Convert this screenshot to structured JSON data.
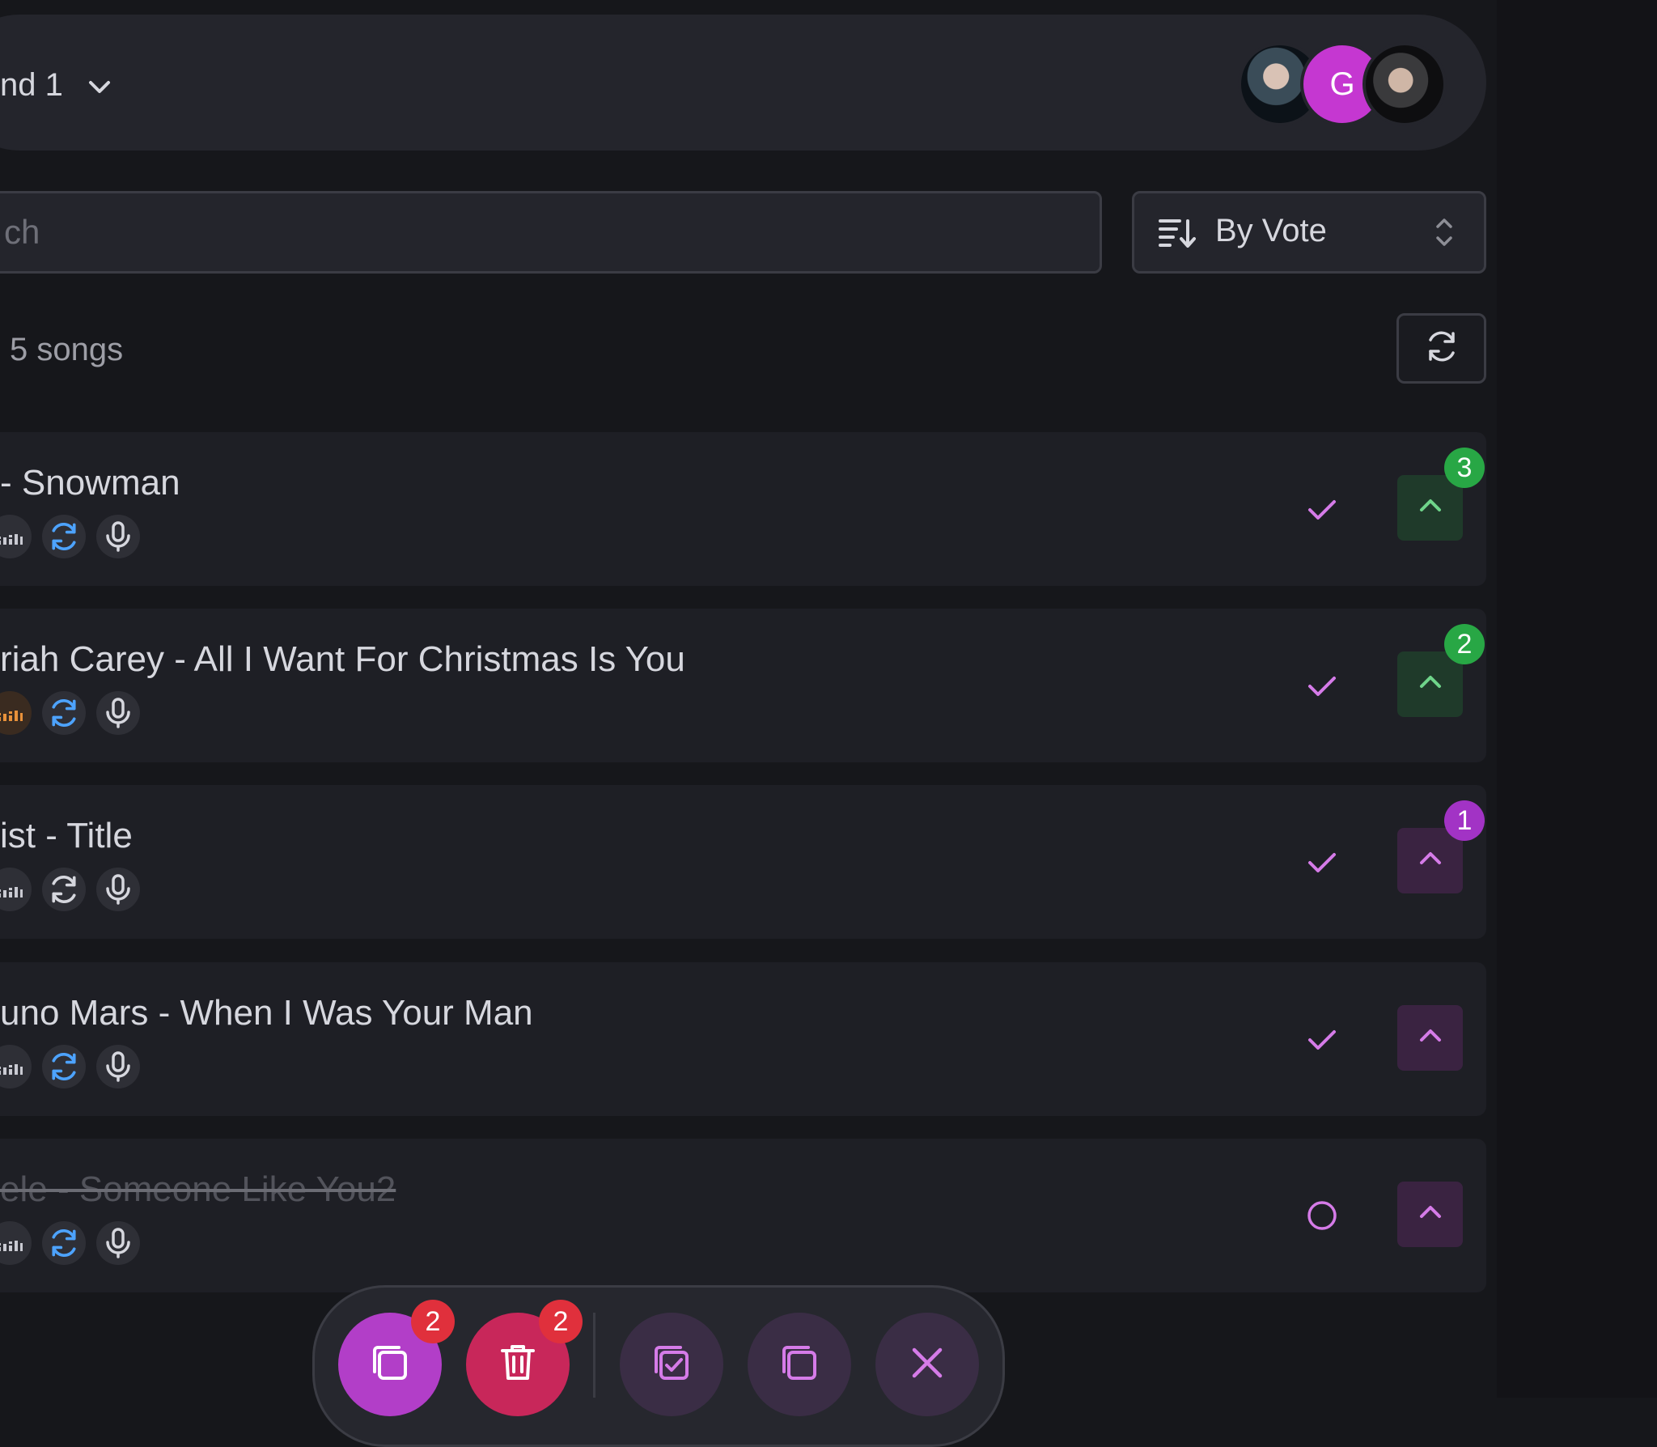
{
  "header": {
    "room_name": "nd 1",
    "avatars": [
      {
        "type": "photo"
      },
      {
        "type": "initial",
        "initial": "G",
        "color": "#c537d1"
      },
      {
        "type": "photo"
      }
    ]
  },
  "search": {
    "placeholder": "ch",
    "value": ""
  },
  "sort": {
    "label": "By Vote"
  },
  "summary": {
    "count_text": "5 songs"
  },
  "songs": [
    {
      "title": "- Snowman",
      "votes": "3",
      "vote_color": "green",
      "status": "done",
      "eq_color": "gray",
      "rotate_color": "blue",
      "struck": false
    },
    {
      "title": "riah Carey - All I Want For Christmas Is You",
      "votes": "2",
      "vote_color": "green",
      "status": "done",
      "eq_color": "orange",
      "rotate_color": "blue",
      "struck": false
    },
    {
      "title": "ist - Title",
      "votes": "1",
      "vote_color": "purple",
      "status": "done",
      "eq_color": "gray",
      "rotate_color": "gray",
      "struck": false
    },
    {
      "title": "uno Mars - When I Was Your Man",
      "votes": "",
      "vote_color": "purple",
      "status": "done",
      "eq_color": "gray",
      "rotate_color": "blue",
      "struck": false
    },
    {
      "title": "ele - Someone Like You2",
      "votes": "",
      "vote_color": "purple",
      "status": "pending",
      "eq_color": "gray",
      "rotate_color": "blue",
      "struck": true
    }
  ],
  "actions": {
    "copy_selected_badge": "2",
    "delete_selected_badge": "2"
  },
  "colors": {
    "accent_purple": "#c537d1",
    "vote_green": "#28a745",
    "delete_red": "#c8275a",
    "check_pink": "#d57be8",
    "rotate_blue": "#4da3ff",
    "eq_orange": "#e8913a"
  }
}
